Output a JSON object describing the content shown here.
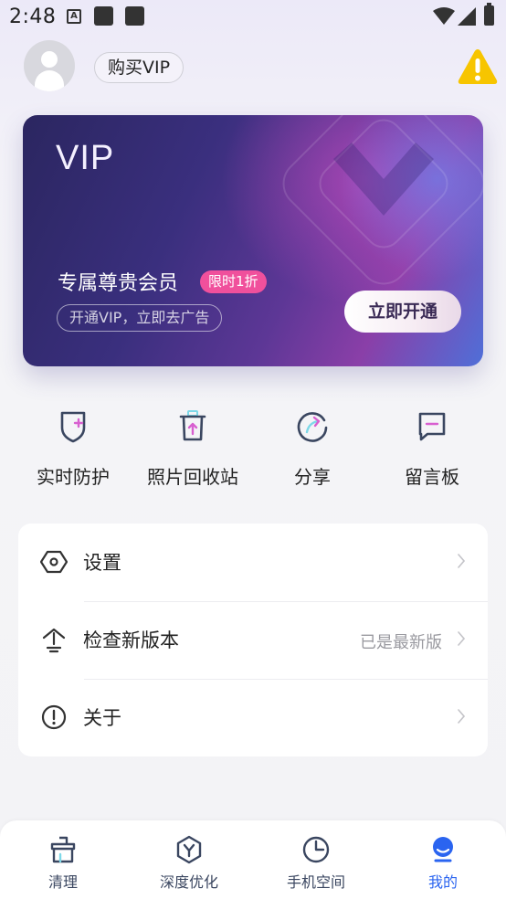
{
  "status_bar": {
    "time": "2:48",
    "notification_icon": "A"
  },
  "header": {
    "buy_vip_label": "购买VIP"
  },
  "vip_card": {
    "title": "VIP",
    "subtitle": "专属尊贵会员",
    "badge": "限时1折",
    "description": "开通VIP，立即去广告",
    "button_label": "立即开通"
  },
  "quick_actions": [
    {
      "label": "实时防护",
      "icon": "shield-plus-icon"
    },
    {
      "label": "照片回收站",
      "icon": "trash-upload-icon"
    },
    {
      "label": "分享",
      "icon": "share-arrow-icon"
    },
    {
      "label": "留言板",
      "icon": "message-board-icon"
    }
  ],
  "menu": [
    {
      "label": "设置",
      "value": "",
      "icon": "settings-hexagon-icon"
    },
    {
      "label": "检查新版本",
      "value": "已是最新版",
      "icon": "update-upload-icon"
    },
    {
      "label": "关于",
      "value": "",
      "icon": "info-exclamation-icon"
    }
  ],
  "bottom_nav": [
    {
      "label": "清理",
      "icon": "broom-icon",
      "active": false
    },
    {
      "label": "深度优化",
      "icon": "hexagon-y-icon",
      "active": false
    },
    {
      "label": "手机空间",
      "icon": "clock-pie-icon",
      "active": false
    },
    {
      "label": "我的",
      "icon": "profile-icon",
      "active": true
    }
  ],
  "colors": {
    "accent_blue": "#2a64f0",
    "badge_pink": "#f0509c",
    "warning_yellow": "#f7c500",
    "card_dark": "#2b2660",
    "card_purple": "#8a3fa8"
  }
}
